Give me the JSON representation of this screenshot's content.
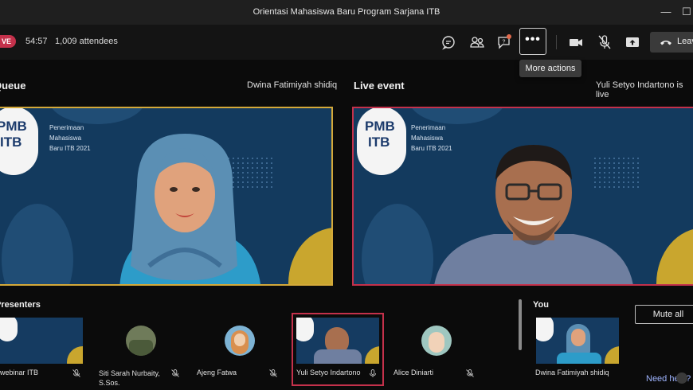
{
  "window": {
    "title": "Orientasi Mahasiswa Baru Program Sarjana ITB",
    "minimize_glyph": "—",
    "maximize_glyph": "☐"
  },
  "toolbar": {
    "live_badge": "VE",
    "elapsed": "54:57",
    "attendees": "1,009 attendees",
    "icons": [
      "chat-icon",
      "people-icon",
      "qa-icon",
      "more-icon",
      "camera-icon",
      "mic-off-icon",
      "share-icon",
      "phone-icon"
    ],
    "more_glyph": "•••",
    "more_tooltip": "More actions",
    "leave_label": "Leave",
    "accent_live": "#c4314b"
  },
  "queue": {
    "heading": "Queue",
    "presenter": "Dwina Fatimiyah shidiq",
    "border_color": "#d4a93a"
  },
  "live_event": {
    "heading": "Live event",
    "status": "Yuli Setyo Indartono is live",
    "border_color": "#c4314b"
  },
  "slide": {
    "logo_line1": "PMB",
    "logo_line2": "ITB",
    "logo_year": "2021",
    "caption_lines": [
      "Penerimaan",
      "Mahasiswa",
      "Baru ITB 2021"
    ]
  },
  "presenters": {
    "heading": "Presenters",
    "items": [
      {
        "label": "webinar ITB",
        "muted": true
      },
      {
        "label": "Siti Sarah Nurbaity, S.Sos.",
        "muted": true
      },
      {
        "label": "Ajeng Fatwa",
        "muted": true
      },
      {
        "label": "Yuli Setyo Indartono",
        "muted": false,
        "selected": true
      },
      {
        "label": "Alice Diniarti",
        "muted": true
      }
    ]
  },
  "you": {
    "heading": "You",
    "name": "Dwina Fatimiyah shidiq",
    "mute_all": "Mute all"
  },
  "footer": {
    "need_help": "Need help?"
  }
}
